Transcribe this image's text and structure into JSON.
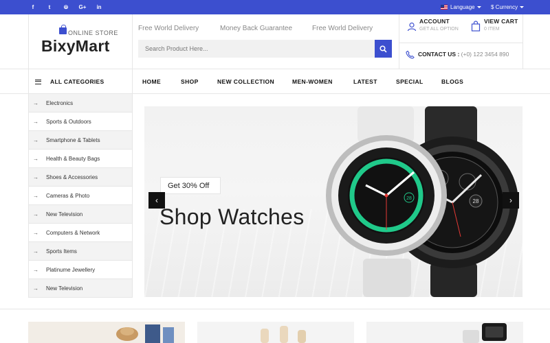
{
  "topbar": {
    "social": [
      {
        "icon": "facebook-icon",
        "glyph": "f"
      },
      {
        "icon": "twitter-icon",
        "glyph": "t"
      },
      {
        "icon": "rss-icon",
        "glyph": "⦾"
      },
      {
        "icon": "google-plus-icon",
        "glyph": "G+"
      },
      {
        "icon": "linkedin-icon",
        "glyph": "in"
      }
    ],
    "language_label": "Language",
    "currency_label": "$ Currency"
  },
  "header": {
    "logo_tagline": "ONLINE STORE",
    "logo_name": "BixyMart",
    "promos": [
      "Free World Delivery",
      "Money Back Guarantee",
      "Free World Delivery"
    ],
    "search_placeholder": "Search Product Here...",
    "account": {
      "title": "ACCOUNT",
      "subtitle": "GET ALL OPTION"
    },
    "cart": {
      "title": "VIEW CART",
      "subtitle": "0 ITEM"
    },
    "contact": {
      "label": "CONTACT US :",
      "phone": "(+0) 122 3454 890"
    }
  },
  "nav": {
    "all_categories": "ALL CATEGORIES",
    "items": [
      "HOME",
      "SHOP",
      "NEW COLLECTION",
      "MEN-WOMEN",
      "LATEST",
      "SPECIAL",
      "BLOGS"
    ]
  },
  "categories": [
    "Electronics",
    "Sports & Outdoors",
    "Smartphone & Tablets",
    "Health & Beauty Bags",
    "Shoes & Accessories",
    "Cameras & Photo",
    "New Television",
    "Computers & Network",
    "Sports Items",
    "Platinume Jewellery",
    "New Television"
  ],
  "slider": {
    "badge": "Get 30% Off",
    "title": "Shop Watches",
    "watch_date_1": "28",
    "watch_date_2": "28"
  },
  "colors": {
    "accent": "#3c4fcf",
    "dark": "#111111",
    "watch_green": "#20c98a"
  }
}
